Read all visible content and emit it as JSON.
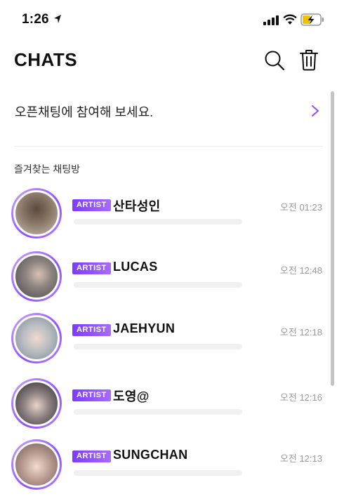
{
  "status_bar": {
    "time": "1:26"
  },
  "header": {
    "title": "CHATS"
  },
  "open_chat": {
    "label": "오픈채팅에 참여해 보세요."
  },
  "section": {
    "favorites_label": "즐겨찾는 채팅방"
  },
  "chats": [
    {
      "badge": "ARTIST",
      "name": "산타성인",
      "time": "오전 01:23",
      "avatar_color": "#8a7868"
    },
    {
      "badge": "ARTIST",
      "name": "LUCAS",
      "time": "오전 12:48",
      "avatar_color": "#6f6b6a"
    },
    {
      "badge": "ARTIST",
      "name": "JAEHYUN",
      "time": "오전 12:18",
      "avatar_color": "#9fa6ad"
    },
    {
      "badge": "ARTIST",
      "name": "도영@",
      "time": "오전 12:16",
      "avatar_color": "#5c5557"
    },
    {
      "badge": "ARTIST",
      "name": "SUNGCHAN",
      "time": "오전 12:13",
      "avatar_color": "#b89a90"
    }
  ],
  "colors": {
    "accent": "#8a4fff",
    "badge": "#7b3cff",
    "time_text": "#9a9a9a"
  }
}
